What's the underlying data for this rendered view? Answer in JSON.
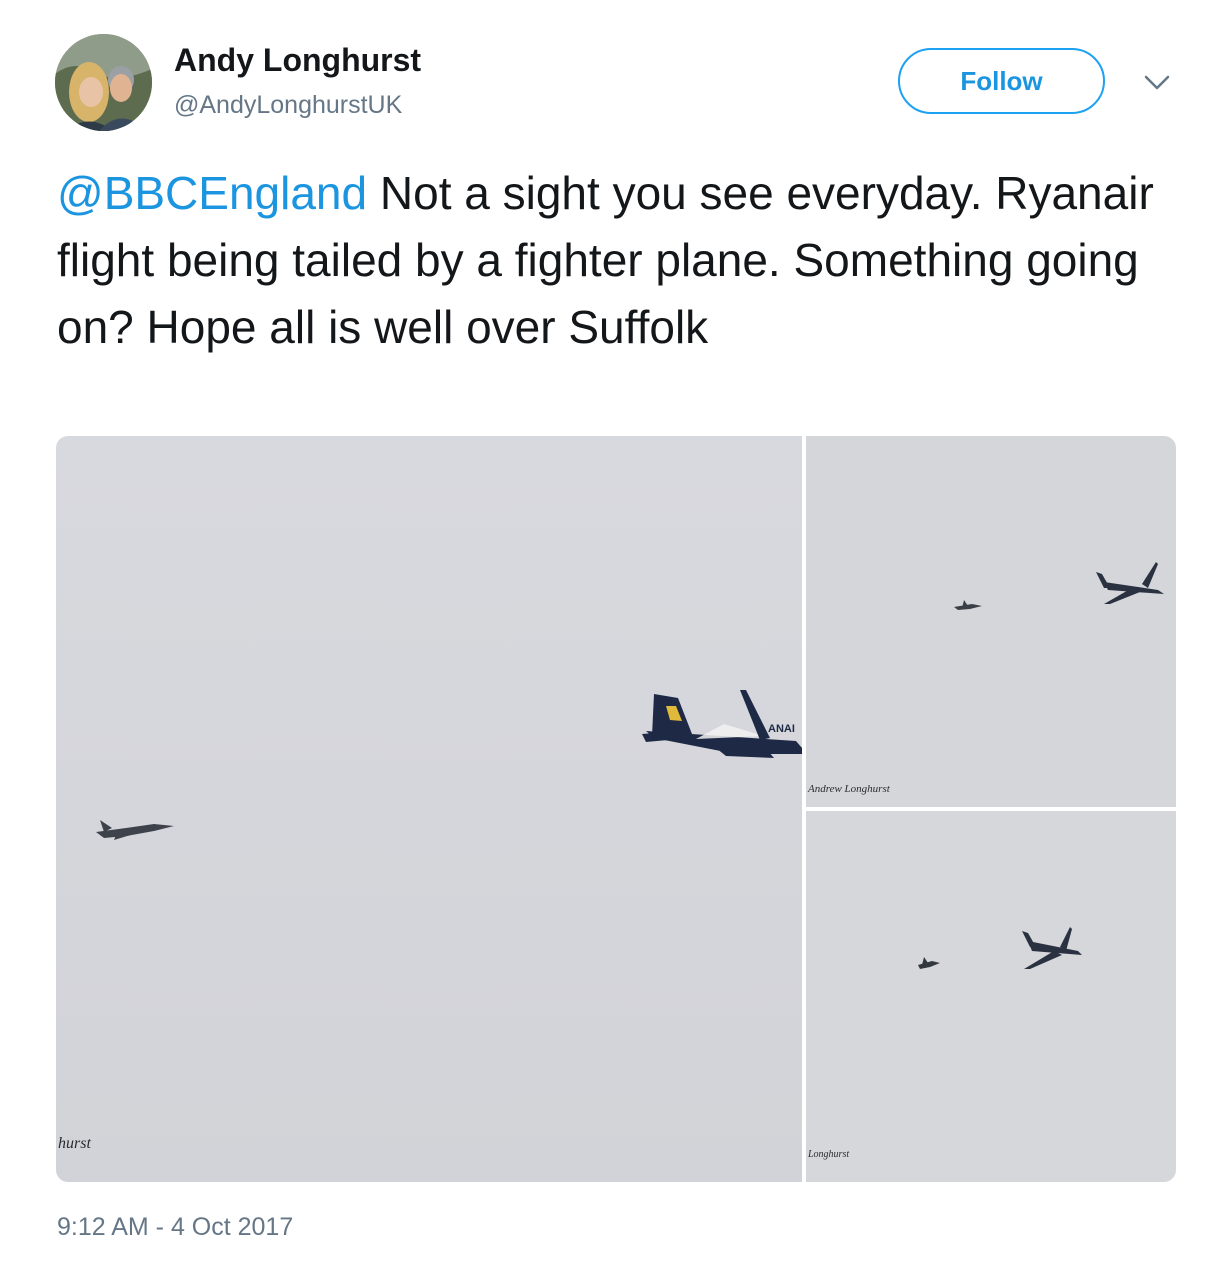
{
  "author": {
    "name": "Andy Longhurst",
    "handle": "@AndyLonghurstUK"
  },
  "actions": {
    "follow_label": "Follow"
  },
  "tweet": {
    "mention": "@BBCEngland",
    "text": " Not a sight you see everyday. Ryanair flight being tailed by a fighter plane. Something going on? Hope all is well over Suffolk",
    "airliner_livery_text": "ANAI",
    "photo_signatures": {
      "main": "hurst",
      "top": "Andrew Longhurst",
      "bottom": "Longhurst"
    }
  },
  "meta": {
    "timestamp": "9:12 AM - 4 Oct 2017"
  },
  "colors": {
    "accent": "#1da1f2",
    "link": "#1b95e0",
    "text_primary": "#14171a",
    "text_secondary": "#657786",
    "sky": "#d6d7db"
  },
  "icons": {
    "caret": "chevron-down-icon"
  }
}
